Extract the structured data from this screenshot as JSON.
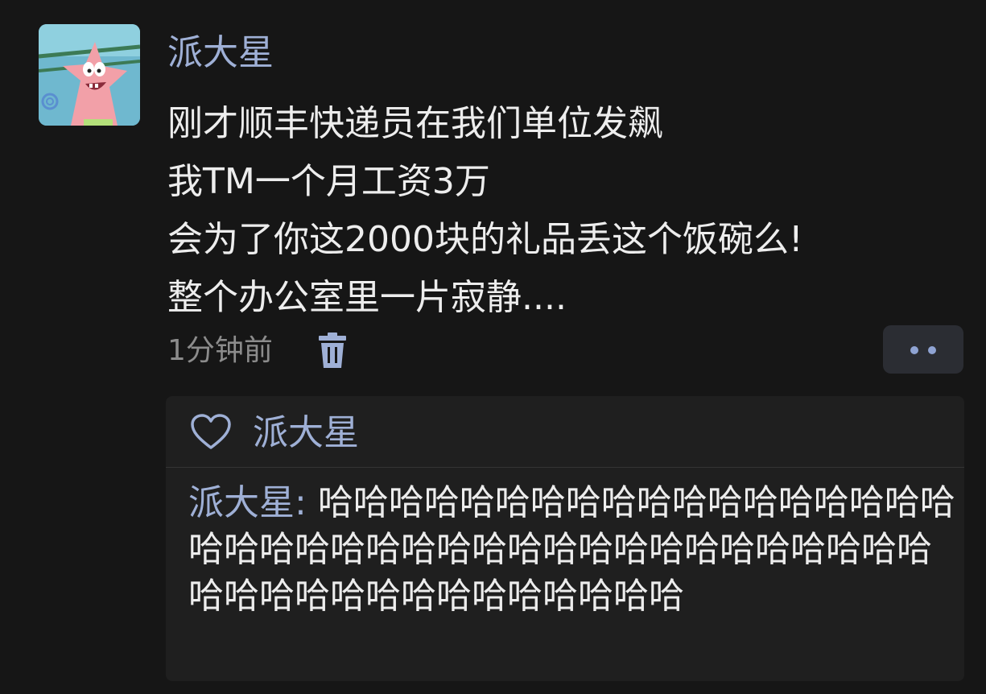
{
  "post": {
    "author": "派大星",
    "content_lines": [
      "刚才顺丰快递员在我们单位发飙",
      "我TM一个月工资3万",
      "会为了你这2000块的礼品丢这个饭碗么!",
      "整个办公室里一片寂静...."
    ],
    "time": "1分钟前",
    "icons": {
      "avatar": "patrick-star-avatar",
      "delete": "trash-icon",
      "more": "more-dots-icon"
    }
  },
  "interactions": {
    "likes": {
      "icon": "heart-icon",
      "names": "派大星"
    },
    "comments": [
      {
        "author": "派大星",
        "separator": ": ",
        "text": "哈哈哈哈哈哈哈哈哈哈哈哈哈哈哈哈哈哈哈哈哈哈哈哈哈哈哈哈哈哈哈哈哈哈哈哈哈哈哈哈哈哈哈哈哈哈哈哈哈哈哈哈哈"
      }
    ]
  },
  "colors": {
    "background": "#161616",
    "name_link": "#9fb0d6",
    "text": "#ededed",
    "muted": "#8c8c8c",
    "panel": "#1f1f1f",
    "button": "#2b2d33"
  }
}
